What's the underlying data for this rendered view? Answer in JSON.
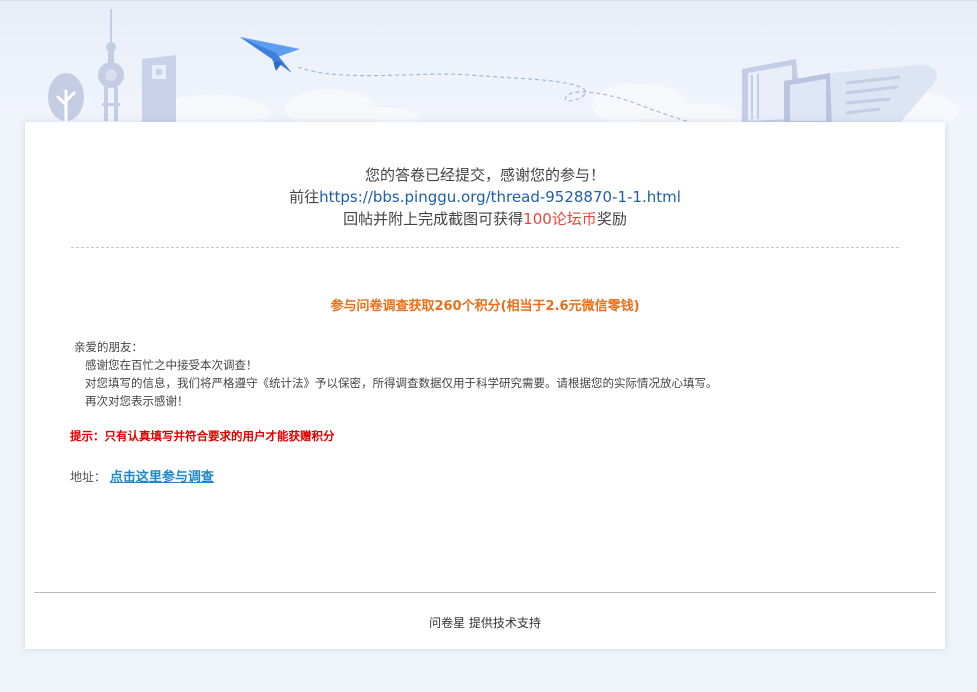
{
  "thanks": {
    "line1": "您的答卷已经提交，感谢您的参与！",
    "line2_prefix": "前往",
    "link_url_text": "https://bbs.pinggu.org/thread-9528870-1-1.html",
    "line3_prefix": "回帖并附上完成截图可获得",
    "reward": "100论坛币",
    "line3_suffix": "奖励"
  },
  "promo": {
    "title": "参与问卷调查获取260个积分(相当于2.6元微信零钱)"
  },
  "letter": {
    "salutation": "亲爱的朋友：",
    "lines": [
      "感谢您在百忙之中接受本次调查！",
      "对您填写的信息，我们将严格遵守《统计法》予以保密，所得调查数据仅用于科学研究需要。请根据您的实际情况放心填写。",
      "再次对您表示感谢！"
    ]
  },
  "tip": "提示：只有认真填写并符合要求的用户才能获赠积分",
  "address": {
    "label": "地址：",
    "link_text": "点击这里参与调查"
  },
  "footer": {
    "brand": "问卷星",
    "text": " 提供技术支持"
  },
  "colors": {
    "link_blue": "#1f5fa8",
    "reward_red": "#e8483c",
    "promo_orange": "#e8701a",
    "tip_red": "#e00000",
    "address_link": "#1f87c8"
  },
  "icons": [
    "tree-icon",
    "tv-tower-icon",
    "building-icon",
    "paper-plane-icon",
    "books-icon",
    "scroll-paper-icon"
  ]
}
